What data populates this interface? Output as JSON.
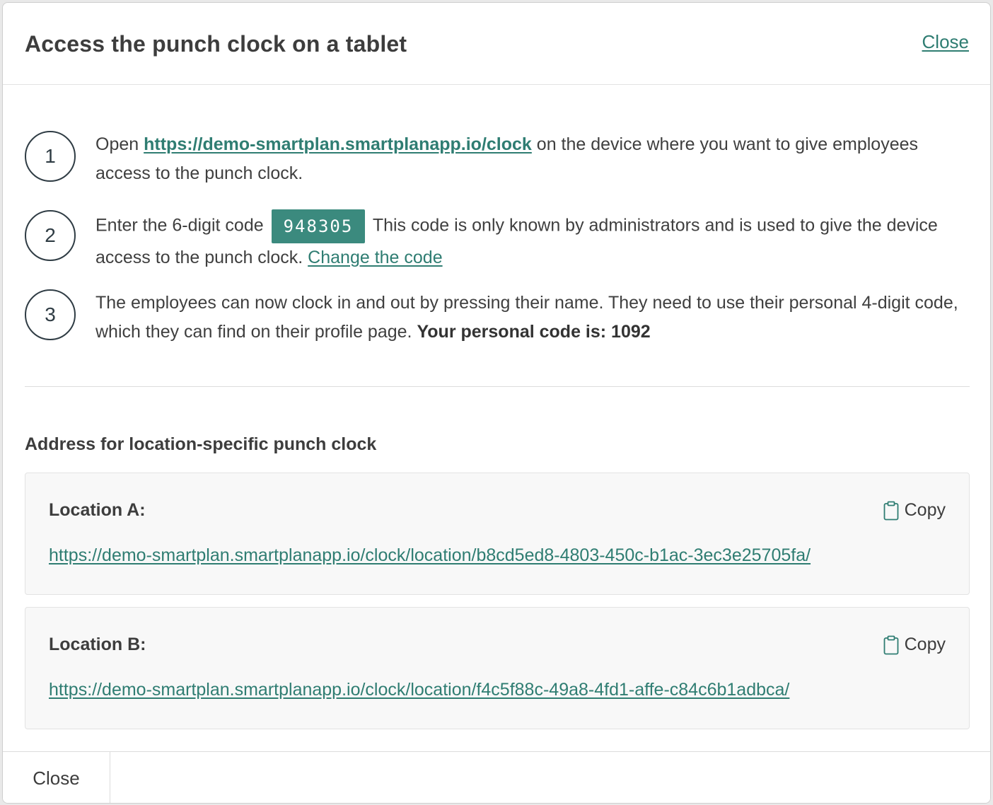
{
  "header": {
    "title": "Access the punch clock on a tablet",
    "close_label": "Close"
  },
  "steps": [
    {
      "number": "1",
      "prefix": "Open",
      "url": "https://demo-smartplan.smartplanapp.io/clock",
      "suffix": "on the device where you want to give employees access to the punch clock."
    },
    {
      "number": "2",
      "prefix": "Enter the 6-digit code",
      "code": "948305",
      "suffix": "This code is only known by administrators and is used to give the device access to the punch clock.",
      "change_link": "Change the code"
    },
    {
      "number": "3",
      "text": "The employees can now clock in and out by pressing their name. They need to use their personal 4-digit code, which they can find on their profile page.",
      "personal_code_label": "Your personal code is: 1092"
    }
  ],
  "locations_section": {
    "label": "Address for location-specific punch clock",
    "copy_label": "Copy",
    "items": [
      {
        "name": "Location A:",
        "url": "https://demo-smartplan.smartplanapp.io/clock/location/b8cd5ed8-4803-450c-b1ac-3ec3e25705fa/"
      },
      {
        "name": "Location B:",
        "url": "https://demo-smartplan.smartplanapp.io/clock/location/f4c5f88c-49a8-4fd1-affe-c84c6b1adbca/"
      }
    ]
  },
  "footer": {
    "close_label": "Close"
  },
  "colors": {
    "accent": "#2f7d72",
    "code_badge": "#3b8a7e"
  }
}
